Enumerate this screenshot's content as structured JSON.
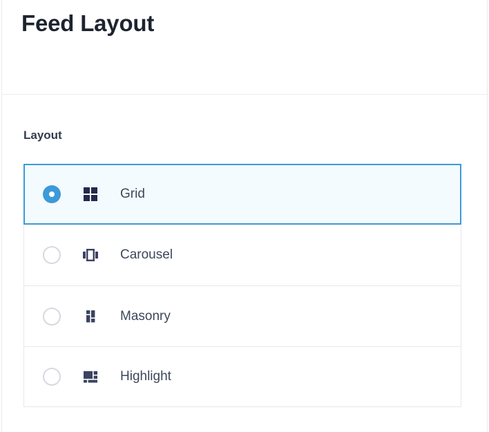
{
  "header": {
    "title": "Feed Layout"
  },
  "colors": {
    "accent": "#3d9ad8",
    "selected_background": "#f4fbfe",
    "selected_border": "#3c9ad6",
    "icon": "#3b4360",
    "label_text": "#3d4759",
    "title_text": "#1d2430",
    "row_border": "#e6e8eb"
  },
  "form": {
    "field_label": "Layout",
    "selected_value": "grid",
    "options": [
      {
        "value": "grid",
        "label": "Grid",
        "icon": "grid-layout-icon",
        "selected": true
      },
      {
        "value": "carousel",
        "label": "Carousel",
        "icon": "carousel-layout-icon",
        "selected": false
      },
      {
        "value": "masonry",
        "label": "Masonry",
        "icon": "masonry-layout-icon",
        "selected": false
      },
      {
        "value": "highlight",
        "label": "Highlight",
        "icon": "highlight-layout-icon",
        "selected": false
      }
    ]
  }
}
